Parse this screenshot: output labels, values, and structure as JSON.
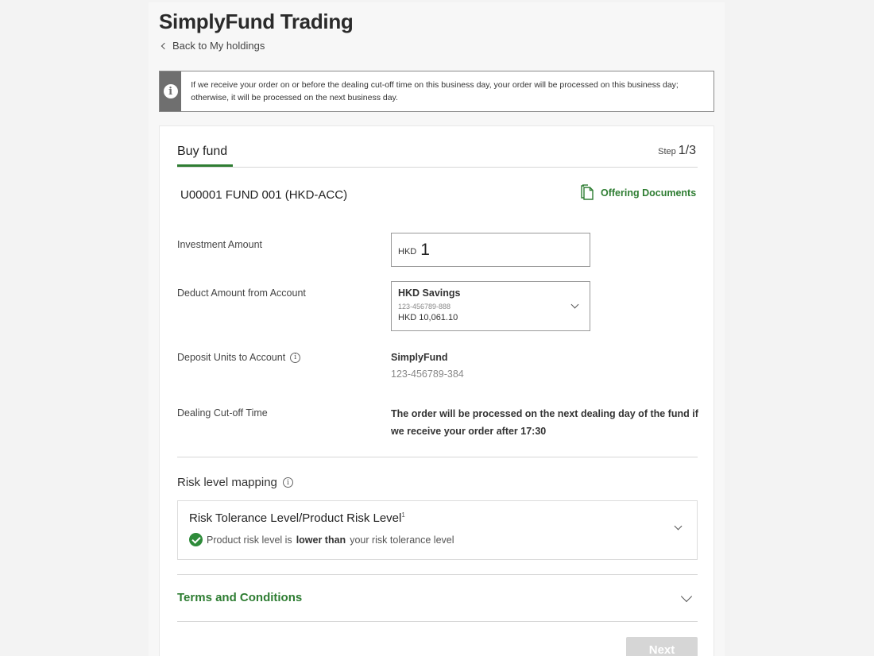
{
  "app": {
    "title": "SimplyFund Trading",
    "back_label": "Back to My holdings"
  },
  "notice": {
    "icon": "info-icon",
    "text": "If we receive your order on or before the dealing cut-off time on this business day, your order will be processed on this business day; otherwise, it will be processed on the next business day."
  },
  "form": {
    "tab_title": "Buy fund",
    "step_label": "Step",
    "step_value": "1/3",
    "fund_name": "U00001  FUND 001 (HKD-ACC)",
    "offering_docs_label": "Offering Documents",
    "investment_amount": {
      "label": "Investment Amount",
      "currency": "HKD",
      "value": "1"
    },
    "deduct_account": {
      "label": "Deduct Amount from Account",
      "name": "HKD Savings",
      "number": "123-456789-888",
      "balance": "HKD 10,061.10"
    },
    "deposit_units": {
      "label": "Deposit Units to Account",
      "name": "SimplyFund",
      "number": "123-456789-384"
    },
    "cutoff": {
      "label": "Dealing Cut-off Time",
      "text": "The order will be processed on the next dealing day of the fund if we receive your order after 17:30"
    },
    "risk": {
      "title": "Risk level mapping",
      "heading": "Risk Tolerance Level/Product Risk Level",
      "footnote": "1",
      "status_prefix": "Product risk level is",
      "status_bold": "lower than",
      "status_suffix": "your risk tolerance level"
    },
    "terms_label": "Terms and Conditions",
    "next_label": "Next"
  },
  "colors": {
    "accent_green": "#2e7d32",
    "notice_bar": "#6f6f6f",
    "disabled_button": "#d6d6d6"
  }
}
